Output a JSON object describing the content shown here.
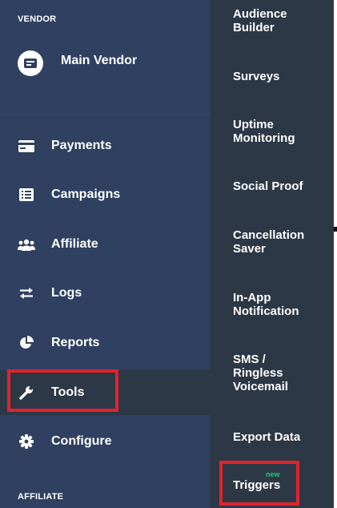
{
  "sidebar": {
    "vendor_section_label": "VENDOR",
    "vendor_name": "Main Vendor",
    "items": [
      {
        "label": "Payments",
        "icon": "credit-card-icon"
      },
      {
        "label": "Campaigns",
        "icon": "list-icon"
      },
      {
        "label": "Affiliate",
        "icon": "users-icon"
      },
      {
        "label": "Logs",
        "icon": "exchange-icon"
      },
      {
        "label": "Reports",
        "icon": "pie-chart-icon"
      },
      {
        "label": "Tools",
        "icon": "wrench-icon",
        "active": true
      },
      {
        "label": "Configure",
        "icon": "gear-icon"
      }
    ],
    "affiliate_section_label": "AFFILIATE"
  },
  "tools_submenu": {
    "items": [
      {
        "label": "Audience\nBuilder"
      },
      {
        "label": "Surveys"
      },
      {
        "label": "Uptime\nMonitoring"
      },
      {
        "label": "Social Proof"
      },
      {
        "label": "Cancellation\nSaver"
      },
      {
        "label": "In-App\nNotification"
      },
      {
        "label": "SMS /\nRingless\nVoicemail"
      },
      {
        "label": "Export Data"
      },
      {
        "label": "Triggers",
        "badge": "new"
      }
    ]
  },
  "colors": {
    "sidebar_bg": "#2f4060",
    "submenu_bg": "#2d3846",
    "highlight": "#e3222b",
    "badge_new": "#28c76f"
  }
}
